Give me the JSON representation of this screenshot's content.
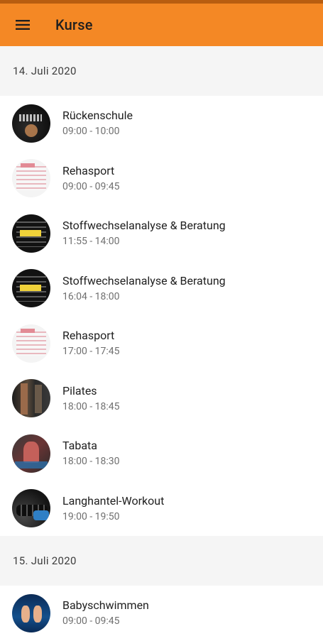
{
  "app_bar": {
    "title": "Kurse",
    "menu_icon": "hamburger-menu-icon",
    "color": "#f48825"
  },
  "sections": [
    {
      "date": "14. Juli 2020",
      "courses": [
        {
          "name": "Rückenschule",
          "time": "09:00 - 10:00",
          "avatar": "chalk"
        },
        {
          "name": "Rehasport",
          "time": "09:00 - 09:45",
          "avatar": "paper"
        },
        {
          "name": "Stoffwechselanalyse & Beratung",
          "time": "11:55 - 14:00",
          "avatar": "words"
        },
        {
          "name": "Stoffwechselanalyse & Beratung",
          "time": "16:04 - 18:00",
          "avatar": "words"
        },
        {
          "name": "Rehasport",
          "time": "17:00 - 17:45",
          "avatar": "paper"
        },
        {
          "name": "Pilates",
          "time": "18:00 - 18:45",
          "avatar": "pilates"
        },
        {
          "name": "Tabata",
          "time": "18:00 - 18:30",
          "avatar": "tabata"
        },
        {
          "name": "Langhantel-Workout",
          "time": "19:00 - 19:50",
          "avatar": "barbell"
        }
      ]
    },
    {
      "date": "15. Juli 2020",
      "courses": [
        {
          "name": "Babyschwimmen",
          "time": "09:00 - 09:45",
          "avatar": "baby"
        }
      ]
    }
  ]
}
